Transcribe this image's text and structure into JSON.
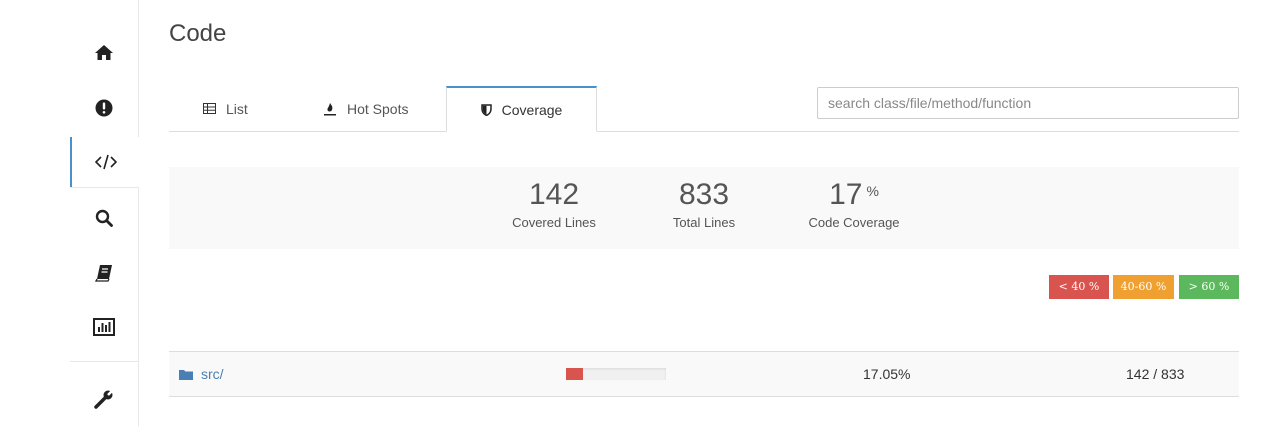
{
  "page": {
    "title": "Code"
  },
  "sidebar": {
    "items": [
      {
        "icon": "home-icon"
      },
      {
        "icon": "alert-icon"
      },
      {
        "icon": "code-icon",
        "active": true
      },
      {
        "icon": "search-icon"
      },
      {
        "icon": "book-icon"
      },
      {
        "icon": "chart-icon"
      },
      {
        "icon": "wrench-icon"
      }
    ]
  },
  "tabs": [
    {
      "label": "List",
      "icon": "table-icon"
    },
    {
      "label": "Hot Spots",
      "icon": "fire-icon"
    },
    {
      "label": "Coverage",
      "icon": "shield-icon",
      "active": true
    }
  ],
  "search": {
    "placeholder": "search class/file/method/function",
    "value": ""
  },
  "stats": {
    "covered": {
      "value": "142",
      "label": "Covered Lines"
    },
    "total": {
      "value": "833",
      "label": "Total Lines"
    },
    "coverage": {
      "value": "17",
      "unit": "%",
      "label": "Code Coverage"
    }
  },
  "legend": [
    {
      "label": "< 40 %",
      "color": "#d9534f"
    },
    {
      "label": "40-60 %",
      "color": "#f0a030"
    },
    {
      "label": "> 60 %",
      "color": "#5cb85c"
    }
  ],
  "rows": [
    {
      "name": "src/",
      "coverage_fraction": 0.1705,
      "percent": "17.05%",
      "lines": "142 / 833"
    }
  ],
  "colors": {
    "accent": "#4a90c9",
    "link": "#4a7fb5",
    "low": "#d9534f",
    "mid": "#f0a030",
    "high": "#5cb85c"
  }
}
